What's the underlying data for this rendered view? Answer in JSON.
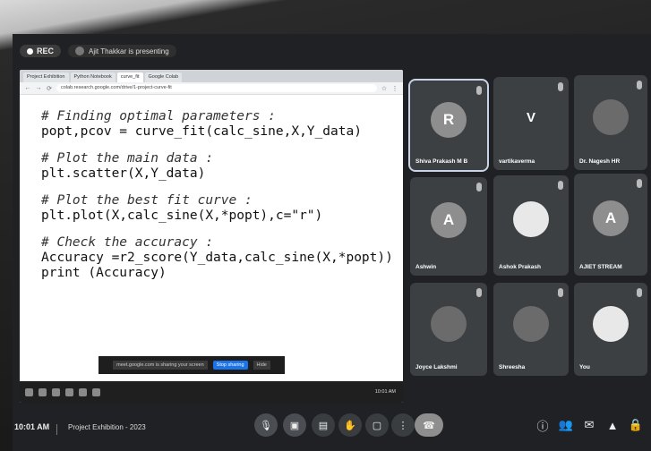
{
  "recording": {
    "label": "REC",
    "status": "Ajit Thakkar is presenting"
  },
  "browser": {
    "tabs": [
      "Project Exhibition",
      "Python Notebook",
      "curve_fit",
      "Google Colab"
    ],
    "url": "colab.research.google.com/drive/1-project-curve-fit"
  },
  "code": {
    "lines": [
      {
        "text": "# Finding optimal parameters :",
        "kind": "comment"
      },
      {
        "text": "popt,pcov = curve_fit(calc_sine,X,Y_data)",
        "kind": "code"
      },
      {
        "text": "",
        "kind": "gap"
      },
      {
        "text": "# Plot the main data :",
        "kind": "comment"
      },
      {
        "text": "plt.scatter(X,Y_data)",
        "kind": "code"
      },
      {
        "text": "",
        "kind": "gap"
      },
      {
        "text": "# Plot the best fit curve :",
        "kind": "comment"
      },
      {
        "text": "plt.plot(X,calc_sine(X,*popt),c=\"r\")",
        "kind": "code"
      },
      {
        "text": "",
        "kind": "gap"
      },
      {
        "text": "# Check the accuracy :",
        "kind": "comment"
      },
      {
        "text": "Accuracy =r2_score(Y_data,calc_sine(X,*popt))",
        "kind": "code"
      },
      {
        "text": "print (Accuracy)",
        "kind": "code"
      }
    ]
  },
  "share_banner": {
    "text": "meet.google.com is sharing your screen",
    "stop_label": "Stop sharing",
    "hide_label": "Hide"
  },
  "taskbar": {
    "clock": "10:01 AM"
  },
  "participants": [
    {
      "name": "Shiva Prakash M B",
      "avatar": "R",
      "type": "letter"
    },
    {
      "name": "vartikaverma",
      "avatar": "V",
      "type": "plain-letter"
    },
    {
      "name": "Dr. Nagesh HR",
      "avatar": "",
      "type": "photo"
    },
    {
      "name": "Ashwin",
      "avatar": "A",
      "type": "letter"
    },
    {
      "name": "Ashok Prakash",
      "avatar": "",
      "type": "white"
    },
    {
      "name": "AJIET STREAM",
      "avatar": "A",
      "type": "letter"
    },
    {
      "name": "Joyce Lakshmi",
      "avatar": "",
      "type": "photo"
    },
    {
      "name": "Shreesha",
      "avatar": "",
      "type": "photo"
    },
    {
      "name": "You",
      "avatar": "",
      "type": "white"
    }
  ],
  "meeting": {
    "time": "10:01 AM",
    "title": "Project Exhibition - 2023"
  },
  "controls": {
    "mic_icon": "mic-icon",
    "camera_icon": "camera-icon",
    "captions_icon": "captions-icon",
    "hand_icon": "raise-hand-icon",
    "present_icon": "present-icon",
    "more_icon": "more-options-icon",
    "leave_icon": "leave-call-icon"
  }
}
